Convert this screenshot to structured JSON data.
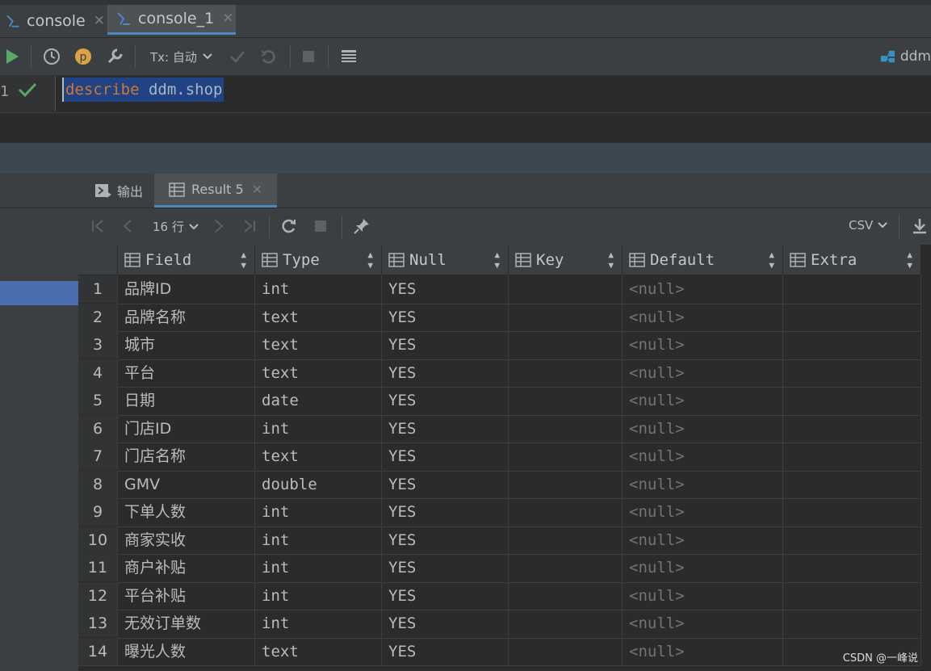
{
  "tabs": [
    {
      "label": "console",
      "close": "✕",
      "active": false
    },
    {
      "label": "console_1",
      "close": "✕",
      "active": true
    }
  ],
  "toolbar": {
    "tx_label": "Tx: 自动",
    "datasource": "ddm"
  },
  "editor": {
    "line_number": "1",
    "keyword": "describe",
    "identifier": "ddm.shop"
  },
  "results": {
    "tabs": [
      {
        "label": "输出",
        "active": false
      },
      {
        "label": "Result 5",
        "active": true,
        "close": "✕"
      }
    ],
    "row_count": "16 行",
    "export_format": "CSV",
    "columns": [
      "Field",
      "Type",
      "Null",
      "Key",
      "Default",
      "Extra"
    ],
    "rows": [
      {
        "n": "1",
        "field": "品牌ID",
        "type": "int",
        "null": "YES",
        "key": "",
        "default": "<null>",
        "extra": ""
      },
      {
        "n": "2",
        "field": "品牌名称",
        "type": "text",
        "null": "YES",
        "key": "",
        "default": "<null>",
        "extra": ""
      },
      {
        "n": "3",
        "field": "城市",
        "type": "text",
        "null": "YES",
        "key": "",
        "default": "<null>",
        "extra": ""
      },
      {
        "n": "4",
        "field": "平台",
        "type": "text",
        "null": "YES",
        "key": "",
        "default": "<null>",
        "extra": ""
      },
      {
        "n": "5",
        "field": "日期",
        "type": "date",
        "null": "YES",
        "key": "",
        "default": "<null>",
        "extra": ""
      },
      {
        "n": "6",
        "field": "门店ID",
        "type": "int",
        "null": "YES",
        "key": "",
        "default": "<null>",
        "extra": ""
      },
      {
        "n": "7",
        "field": "门店名称",
        "type": "text",
        "null": "YES",
        "key": "",
        "default": "<null>",
        "extra": ""
      },
      {
        "n": "8",
        "field": "GMV",
        "type": "double",
        "null": "YES",
        "key": "",
        "default": "<null>",
        "extra": ""
      },
      {
        "n": "9",
        "field": "下单人数",
        "type": "int",
        "null": "YES",
        "key": "",
        "default": "<null>",
        "extra": ""
      },
      {
        "n": "10",
        "field": "商家实收",
        "type": "int",
        "null": "YES",
        "key": "",
        "default": "<null>",
        "extra": ""
      },
      {
        "n": "11",
        "field": "商户补贴",
        "type": "int",
        "null": "YES",
        "key": "",
        "default": "<null>",
        "extra": ""
      },
      {
        "n": "12",
        "field": "平台补贴",
        "type": "int",
        "null": "YES",
        "key": "",
        "default": "<null>",
        "extra": ""
      },
      {
        "n": "13",
        "field": "无效订单数",
        "type": "int",
        "null": "YES",
        "key": "",
        "default": "<null>",
        "extra": ""
      },
      {
        "n": "14",
        "field": "曝光人数",
        "type": "text",
        "null": "YES",
        "key": "",
        "default": "<null>",
        "extra": ""
      }
    ]
  },
  "watermark": "CSDN @一峰说",
  "colors": {
    "accent": "#4a88c7",
    "selection": "#214283",
    "keyword": "#cc7832",
    "run": "#59a869",
    "check": "#59a869"
  }
}
